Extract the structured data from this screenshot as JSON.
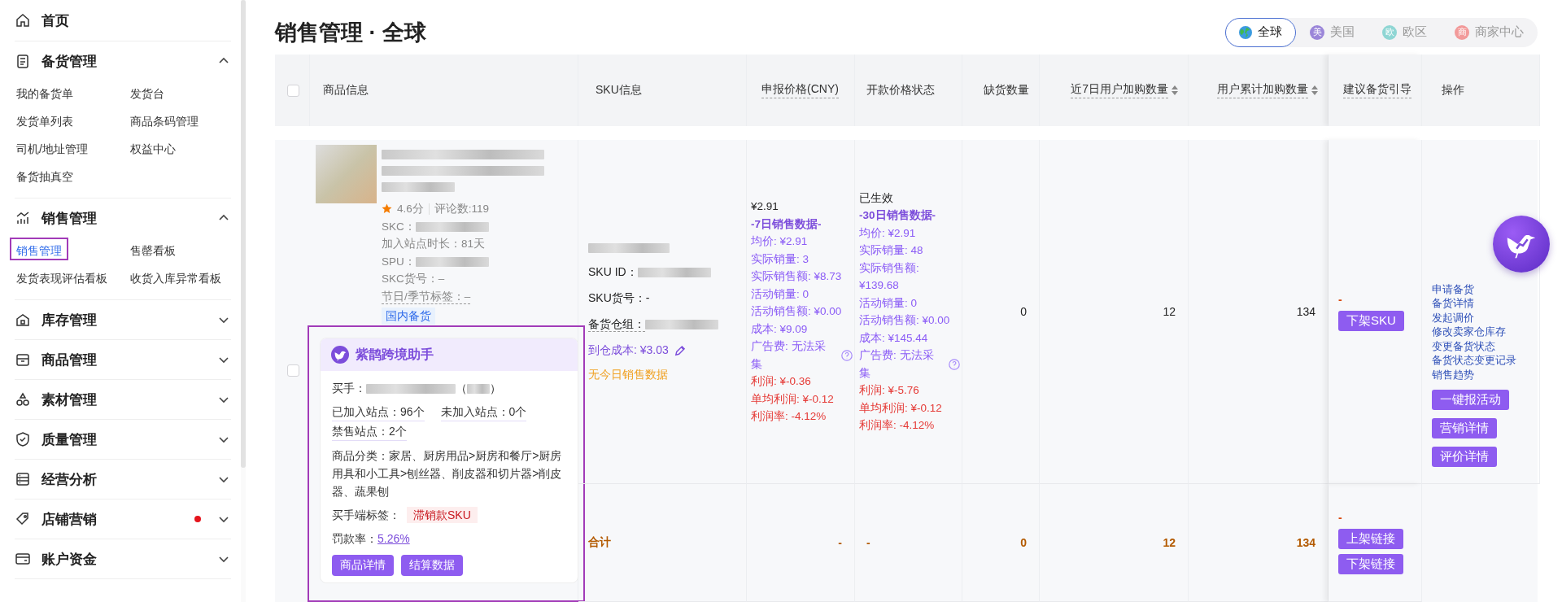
{
  "sidebar": {
    "items": [
      {
        "kind": "link",
        "label": "首页"
      },
      {
        "kind": "group",
        "label": "备货管理",
        "expanded": true,
        "dot": false,
        "children": [
          {
            "label": "我的备货单",
            "selected": false
          },
          {
            "label": "发货台",
            "selected": false
          },
          {
            "label": "发货单列表",
            "selected": false
          },
          {
            "label": "商品条码管理",
            "selected": false
          },
          {
            "label": "司机/地址管理",
            "selected": false
          },
          {
            "label": "权益中心",
            "selected": false
          },
          {
            "label": "备货抽真空",
            "selected": false
          }
        ]
      },
      {
        "kind": "group",
        "label": "销售管理",
        "expanded": true,
        "dot": false,
        "children": [
          {
            "label": "销售管理",
            "selected": true
          },
          {
            "label": "售罄看板",
            "selected": false
          },
          {
            "label": "发货表现评估看板",
            "selected": false
          },
          {
            "label": "收货入库异常看板",
            "selected": false
          }
        ]
      },
      {
        "kind": "group",
        "label": "库存管理",
        "expanded": false,
        "dot": false
      },
      {
        "kind": "group",
        "label": "商品管理",
        "expanded": false,
        "dot": false
      },
      {
        "kind": "group",
        "label": "素材管理",
        "expanded": false,
        "dot": false
      },
      {
        "kind": "group",
        "label": "质量管理",
        "expanded": false,
        "dot": false
      },
      {
        "kind": "group",
        "label": "经营分析",
        "expanded": false,
        "dot": false
      },
      {
        "kind": "group",
        "label": "店铺营销",
        "expanded": false,
        "dot": true
      },
      {
        "kind": "group",
        "label": "账户资金",
        "expanded": false,
        "dot": false
      }
    ]
  },
  "header": {
    "title": "销售管理 · 全球",
    "regions": [
      {
        "kind": "globe",
        "label": "全球",
        "selected": true
      },
      {
        "kind": "badge",
        "badge": "美",
        "label": "美国",
        "color": "#9b86d9",
        "selected": false
      },
      {
        "kind": "badge",
        "badge": "欧",
        "label": "欧区",
        "color": "#8fd6d4",
        "selected": false
      },
      {
        "kind": "badge",
        "badge": "商",
        "label": "商家中心",
        "color": "#f29a9a",
        "selected": false
      }
    ]
  },
  "table": {
    "select_all_checked": false,
    "columns": [
      {
        "label": "商品信息",
        "hint": false,
        "sortable": false
      },
      {
        "label": "SKU信息",
        "hint": false,
        "sortable": false
      },
      {
        "label": "申报价格(CNY)",
        "hint": true,
        "sortable": false
      },
      {
        "label": "开款价格状态",
        "hint": false,
        "sortable": false
      },
      {
        "label": "缺货数量",
        "hint": false,
        "sortable": false
      },
      {
        "label": "近7日用户加购数量",
        "hint": true,
        "sortable": true
      },
      {
        "label": "用户累计加购数量",
        "hint": true,
        "sortable": true
      },
      {
        "label": "建议备货引导",
        "hint": true,
        "sortable": false
      },
      {
        "label": "操作",
        "hint": false,
        "sortable": false
      }
    ],
    "rows": [
      {
        "checked": false,
        "product": {
          "rating": "4.6分",
          "reviews": "评论数:119",
          "fields": [
            {
              "text": "SKC：",
              "redacted": true,
              "hint": false
            },
            {
              "text": "加入站点时长：81天",
              "redacted": false,
              "hint": false
            },
            {
              "text": "SPU：",
              "redacted": true,
              "hint": false
            },
            {
              "text": "SKC货号：–",
              "redacted": false,
              "hint": false
            },
            {
              "text": "节日/季节标签：–",
              "redacted": false,
              "hint": true
            }
          ],
          "tag": "国内备货"
        },
        "assistant": {
          "title": "紫鹊跨境助手",
          "buyer_label": "买手：",
          "buyer_open": "（",
          "buyer_close": "）",
          "sites": [
            "已加入站点：96个",
            "未加入站点：0个",
            "禁售站点：2个"
          ],
          "category": "商品分类：家居、厨房用品>厨房和餐厅>厨房用具和小工具>刨丝器、削皮器和切片器>削皮器、蔬果刨",
          "tag_label": "买手端标签：",
          "tag": "滞销款SKU",
          "penalty_label": "罚款率：",
          "penalty": "5.26%",
          "buttons": [
            "商品详情",
            "结算数据"
          ]
        },
        "sku": {
          "fields": [
            {
              "text": "SKU ID：",
              "redacted": true,
              "hint": false
            },
            {
              "text": "SKU货号：-",
              "redacted": false,
              "hint": false
            },
            {
              "text": "备货仓组：",
              "redacted": true,
              "hint": true
            }
          ],
          "arrival_cost": "到仓成本: ¥3.03",
          "today": "无今日销售数据"
        },
        "price": {
          "value": "¥2.91",
          "lines": [
            {
              "kind": "heading",
              "text": "-7日销售数据-",
              "help": false
            },
            {
              "kind": "stat",
              "text": "均价: ¥2.91",
              "help": false
            },
            {
              "kind": "stat",
              "text": "实际销量: 3",
              "help": false
            },
            {
              "kind": "stat",
              "text": "实际销售额: ¥8.73",
              "help": false
            },
            {
              "kind": "stat",
              "text": "活动销量: 0",
              "help": false
            },
            {
              "kind": "stat",
              "text": "活动销售额: ¥0.00",
              "help": false
            },
            {
              "kind": "stat",
              "text": "成本: ¥9.09",
              "help": false
            },
            {
              "kind": "stat",
              "text": "广告费: 无法采集",
              "help": true
            },
            {
              "kind": "loss",
              "text": "利润: ¥-0.36",
              "help": false
            },
            {
              "kind": "loss",
              "text": "单均利润: ¥-0.12",
              "help": false
            },
            {
              "kind": "loss",
              "text": "利润率: -4.12%",
              "help": false
            }
          ]
        },
        "status": {
          "value": "已生效",
          "lines": [
            {
              "kind": "heading",
              "text": "-30日销售数据-",
              "help": false
            },
            {
              "kind": "stat",
              "text": "均价: ¥2.91",
              "help": false
            },
            {
              "kind": "stat",
              "text": "实际销量: 48",
              "help": false
            },
            {
              "kind": "stat",
              "text": "实际销售额: ¥139.68",
              "help": false
            },
            {
              "kind": "stat",
              "text": "活动销量: 0",
              "help": false
            },
            {
              "kind": "stat",
              "text": "活动销售额: ¥0.00",
              "help": false
            },
            {
              "kind": "stat",
              "text": "成本: ¥145.44",
              "help": false
            },
            {
              "kind": "stat",
              "text": "广告费: 无法采集",
              "help": true
            },
            {
              "kind": "loss",
              "text": "利润: ¥-5.76",
              "help": false
            },
            {
              "kind": "loss",
              "text": "单均利润: ¥-0.12",
              "help": false
            },
            {
              "kind": "loss",
              "text": "利润率: -4.12%",
              "help": false
            }
          ]
        },
        "stockout": "0",
        "cart_7d": "12",
        "cart_total": "134",
        "suggest": {
          "value": "-",
          "button": "下架SKU"
        },
        "actions": {
          "links": [
            "申请备货",
            "备货详情",
            "发起调价",
            "修改卖家仓库存",
            "变更备货状态",
            "备货状态变更记录",
            "销售趋势"
          ],
          "buttons": [
            "一键报活动",
            "营销详情",
            "评价详情"
          ]
        }
      }
    ],
    "summary": {
      "label": "合计",
      "price": "-",
      "status": "-",
      "stockout": "0",
      "cart_7d": "12",
      "cart_total": "134",
      "suggest": "-",
      "buttons": [
        "上架链接",
        "下架链接"
      ]
    }
  }
}
